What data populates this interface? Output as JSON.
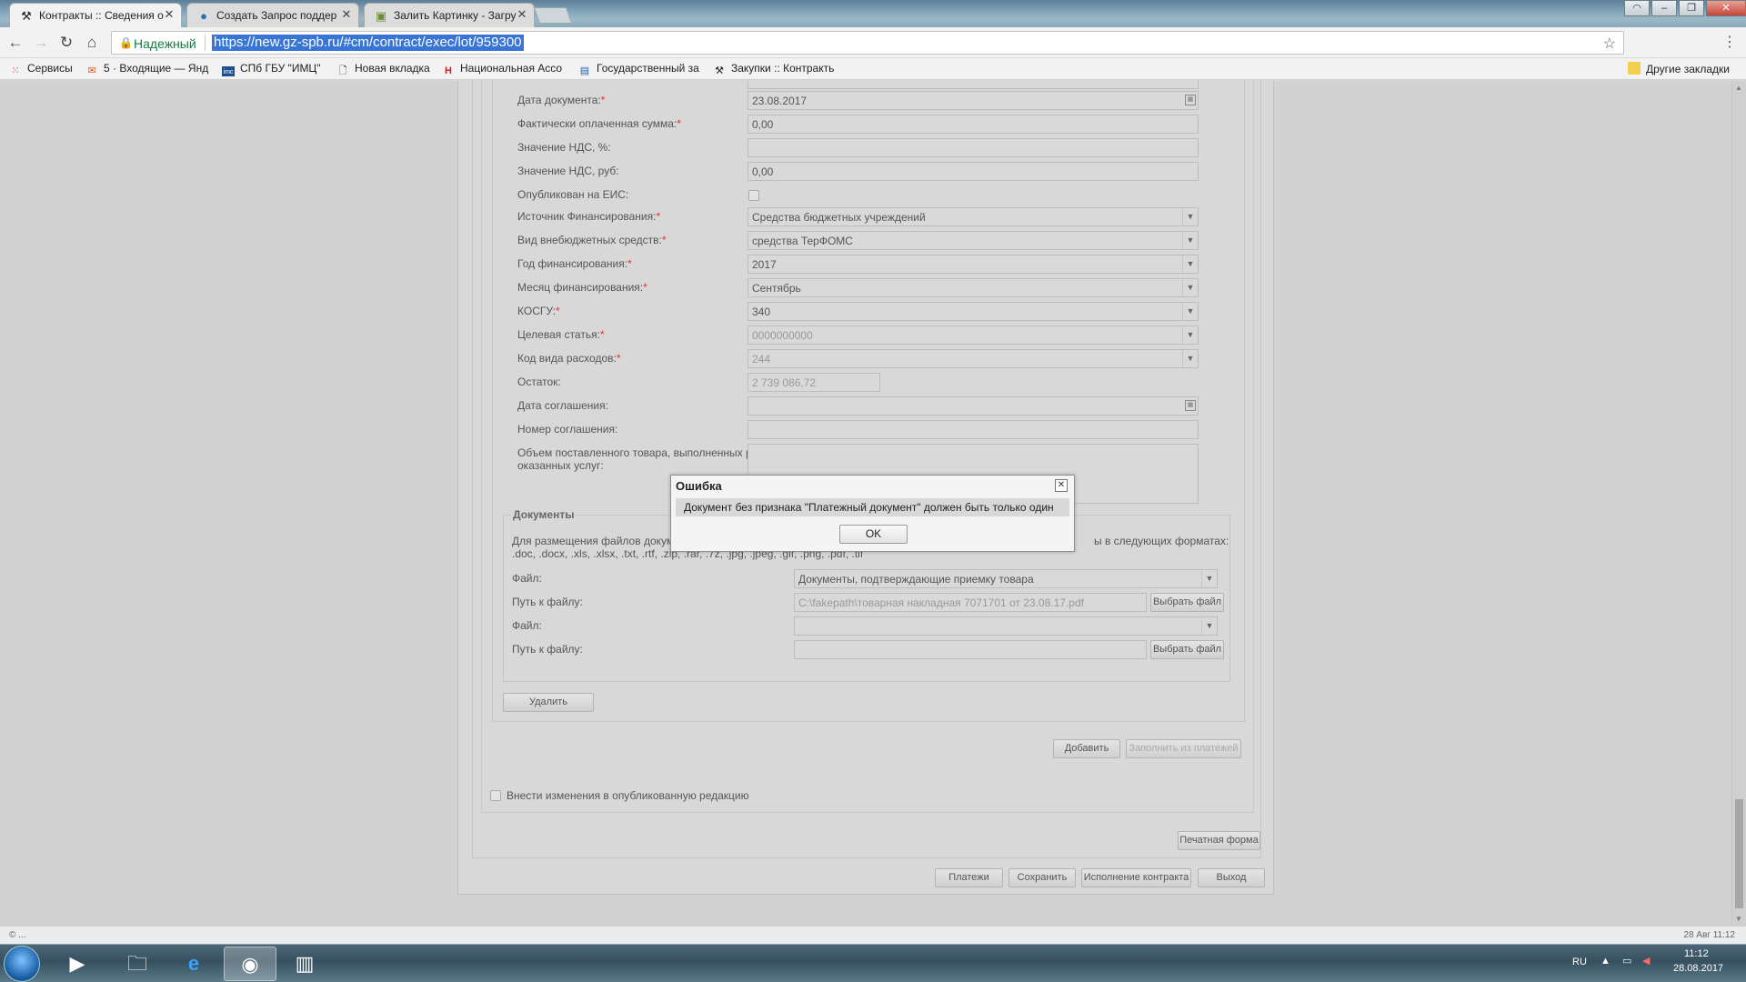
{
  "browser": {
    "tabs": [
      {
        "title": "Контракты :: Сведения о",
        "icon": "tools-icon",
        "active": true
      },
      {
        "title": "Создать Запрос поддер",
        "icon": "globe-icon",
        "active": false
      },
      {
        "title": "Залить Картинку - Загру",
        "icon": "image-icon",
        "active": false
      }
    ],
    "secure_label": "Надежный",
    "url": "https://new.gz-spb.ru/#cm/contract/exec/lot/959300"
  },
  "bookmarks": {
    "items": [
      {
        "label": "Сервисы",
        "icon": "apps-grid-icon"
      },
      {
        "label": "5 · Входящие — Янд",
        "icon": "mail-icon"
      },
      {
        "label": "СПб ГБУ \"ИМЦ\"",
        "icon": "imc-logo-icon"
      },
      {
        "label": "Новая вкладка",
        "icon": "page-icon"
      },
      {
        "label": "Национальная Ассо",
        "icon": "nacc-logo-icon"
      },
      {
        "label": "Государственный за",
        "icon": "gov-logo-icon"
      },
      {
        "label": "Закупки :: Контракть",
        "icon": "tools-icon"
      }
    ],
    "other": "Другие закладки"
  },
  "form": {
    "fields": [
      {
        "label": "Дата документа:",
        "required": true,
        "value": "23.08.2017",
        "kind": "date"
      },
      {
        "label": "Фактически оплаченная сумма:",
        "required": true,
        "value": "0,00",
        "kind": "text"
      },
      {
        "label": "Значение НДС, %:",
        "required": false,
        "value": "",
        "kind": "text"
      },
      {
        "label": "Значение НДС, руб:",
        "required": false,
        "value": "0,00",
        "kind": "text"
      },
      {
        "label": "Опубликован на ЕИС:",
        "required": false,
        "value": "",
        "kind": "checkbox"
      },
      {
        "label": "Источник Финансирования:",
        "required": true,
        "value": "Средства бюджетных учреждений",
        "kind": "select"
      },
      {
        "label": "Вид внебюджетных средств:",
        "required": true,
        "value": "средства ТерФОМС",
        "kind": "select"
      },
      {
        "label": "Год финансирования:",
        "required": true,
        "value": "2017",
        "kind": "select"
      },
      {
        "label": "Месяц финансирования:",
        "required": true,
        "value": "Сентябрь",
        "kind": "select"
      },
      {
        "label": "КОСГУ:",
        "required": true,
        "value": "340",
        "kind": "select"
      },
      {
        "label": "Целевая статья:",
        "required": true,
        "value": "0000000000",
        "kind": "select-disabled"
      },
      {
        "label": "Код вида расходов:",
        "required": true,
        "value": "244",
        "kind": "select-disabled"
      },
      {
        "label": "Остаток:",
        "required": false,
        "value": "2 739 086,72",
        "kind": "short-disabled"
      },
      {
        "label": "Дата соглашения:",
        "required": false,
        "value": "",
        "kind": "date"
      },
      {
        "label": "Номер соглашения:",
        "required": false,
        "value": "",
        "kind": "text"
      }
    ],
    "volume_label_line1": "Объем поставленного товара, выполненных работ,",
    "volume_label_line2": "оказанных услуг:",
    "required_mark": "*"
  },
  "documents": {
    "legend": "Документы",
    "info_line1_left": "Для размещения файлов докум",
    "info_line1_right": "ы в следующих форматах:",
    "info_line2": ".doc, .docx, .xls, .xlsx, .txt, .rtf, .zip, .rar, .7z, .jpg, .jpeg, .gif, .png, .pdf, .tif",
    "file_label": "Файл:",
    "path_label": "Путь к файлу:",
    "file1_value": "Документы, подтверждающие приемку товара",
    "path1_value": "C:\\fakepath\\товарная накладная 7071701 от 23.08.17.pdf",
    "file2_value": "",
    "path2_value": "",
    "choose_file": "Выбрать файл"
  },
  "buttons": {
    "delete": "Удалить",
    "add": "Добавить",
    "fill_from_payments": "Заполнить из платежей",
    "publish_changes": "Внести изменения в опубликованную редакцию",
    "print_form": "Печатная форма",
    "payments": "Платежи",
    "save": "Сохранить",
    "contract_execution": "Исполнение контракта",
    "exit": "Выход"
  },
  "modal": {
    "title": "Ошибка",
    "message": "Документ без признака \"Платежный документ\" должен быть только один",
    "ok": "OK"
  },
  "statusbar": {
    "left": "© ...",
    "right": "28 Авг 11:12"
  },
  "taskbar": {
    "lang": "RU",
    "time": "11:12",
    "date": "28.08.2017"
  }
}
